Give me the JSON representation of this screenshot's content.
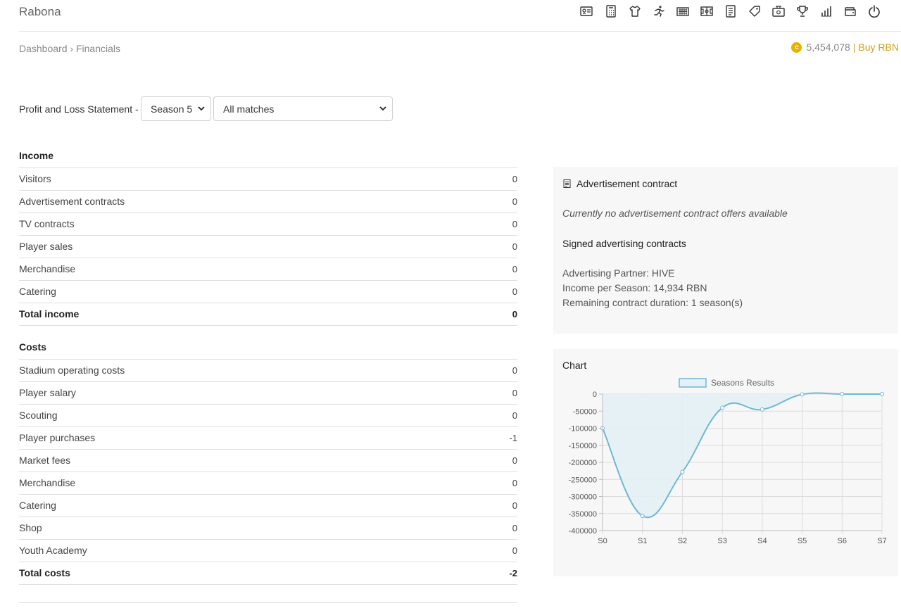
{
  "app": {
    "title": "Rabona"
  },
  "nav_icons": [
    "id-card-icon",
    "calculator-icon",
    "shirt-icon",
    "running-icon",
    "stadium-icon",
    "field-icon",
    "document-icon",
    "tag-icon",
    "money-icon",
    "trophy-icon",
    "stats-icon",
    "wallet-icon",
    "power-icon"
  ],
  "breadcrumb": {
    "home": "Dashboard",
    "sep": "›",
    "current": "Financials"
  },
  "balance": {
    "amount": "5,454,078",
    "sep": "|",
    "buy": "Buy RBN",
    "coin_color": "#e9b100"
  },
  "filter": {
    "label": "Profit and Loss Statement -",
    "season": "Season 5",
    "matches": "All matches"
  },
  "income": {
    "heading": "Income",
    "rows": [
      {
        "label": "Visitors",
        "value": "0"
      },
      {
        "label": "Advertisement contracts",
        "value": "0"
      },
      {
        "label": "TV contracts",
        "value": "0"
      },
      {
        "label": "Player sales",
        "value": "0"
      },
      {
        "label": "Merchandise",
        "value": "0"
      },
      {
        "label": "Catering",
        "value": "0"
      }
    ],
    "total": {
      "label": "Total income",
      "value": "0"
    }
  },
  "costs": {
    "heading": "Costs",
    "rows": [
      {
        "label": "Stadium operating costs",
        "value": "0"
      },
      {
        "label": "Player salary",
        "value": "0"
      },
      {
        "label": "Scouting",
        "value": "0"
      },
      {
        "label": "Player purchases",
        "value": "-1"
      },
      {
        "label": "Market fees",
        "value": "0"
      },
      {
        "label": "Merchandise",
        "value": "0"
      },
      {
        "label": "Catering",
        "value": "0"
      },
      {
        "label": "Shop",
        "value": "0"
      },
      {
        "label": "Youth Academy",
        "value": "0"
      }
    ],
    "total": {
      "label": "Total costs",
      "value": "-2"
    }
  },
  "advertisement": {
    "title": "Advertisement contract",
    "none_text": "Currently no advertisement contract offers available",
    "signed_title": "Signed advertising contracts",
    "partner": "Advertising Partner: HIVE",
    "income": "Income per Season: 14,934 RBN",
    "duration": "Remaining contract duration: 1 season(s)"
  },
  "chart_panel": {
    "title": "Chart"
  },
  "chart_data": {
    "type": "area",
    "title": "",
    "xlabel": "",
    "ylabel": "",
    "categories": [
      "S0",
      "S1",
      "S2",
      "S3",
      "S4",
      "S5",
      "S6",
      "S7"
    ],
    "series": [
      {
        "name": "Seasons Results",
        "values": [
          -100000,
          -357000,
          -228000,
          -40000,
          -45000,
          -1000,
          0,
          0
        ]
      }
    ],
    "ylim": [
      -400000,
      0
    ],
    "yticks": [
      0,
      -50000,
      -100000,
      -150000,
      -200000,
      -250000,
      -300000,
      -350000,
      -400000
    ],
    "grid": true,
    "legend": "top",
    "line_color": "#6fb8d3",
    "fill_color": "#e3f0f5"
  }
}
